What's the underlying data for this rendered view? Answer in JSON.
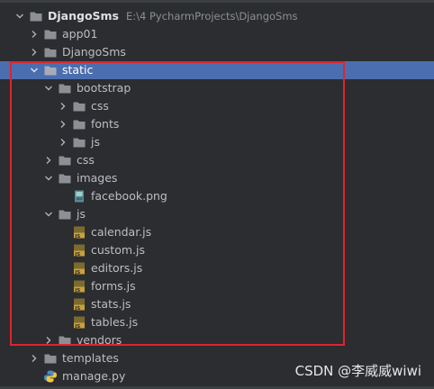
{
  "project": {
    "name": "DjangoSms",
    "path": "E:\\4 PycharmProjects\\DjangoSms"
  },
  "tree": [
    {
      "label": "app01",
      "type": "folder",
      "expanded": false
    },
    {
      "label": "DjangoSms",
      "type": "folder",
      "expanded": false
    },
    {
      "label": "static",
      "type": "folder",
      "expanded": true,
      "selected": true
    },
    {
      "label": "bootstrap",
      "type": "folder",
      "expanded": true
    },
    {
      "label": "css",
      "type": "folder",
      "expanded": false
    },
    {
      "label": "fonts",
      "type": "folder",
      "expanded": false
    },
    {
      "label": "js",
      "type": "folder",
      "expanded": false
    },
    {
      "label": "css",
      "type": "folder",
      "expanded": false
    },
    {
      "label": "images",
      "type": "folder",
      "expanded": true
    },
    {
      "label": "facebook.png",
      "type": "image-file"
    },
    {
      "label": "js",
      "type": "folder",
      "expanded": true
    },
    {
      "label": "calendar.js",
      "type": "js-file"
    },
    {
      "label": "custom.js",
      "type": "js-file"
    },
    {
      "label": "editors.js",
      "type": "js-file"
    },
    {
      "label": "forms.js",
      "type": "js-file"
    },
    {
      "label": "stats.js",
      "type": "js-file"
    },
    {
      "label": "tables.js",
      "type": "js-file"
    },
    {
      "label": "vendors",
      "type": "folder",
      "expanded": false
    },
    {
      "label": "templates",
      "type": "folder",
      "expanded": false
    },
    {
      "label": "manage.py",
      "type": "python-file"
    }
  ],
  "watermark": "CSDN @李威威wiwi",
  "colors": {
    "background": "#2b2d30",
    "selection": "#4b6eaf",
    "highlight_border": "#e0242c",
    "folder": "#8c8f94",
    "js_badge": "#c8a13a"
  }
}
